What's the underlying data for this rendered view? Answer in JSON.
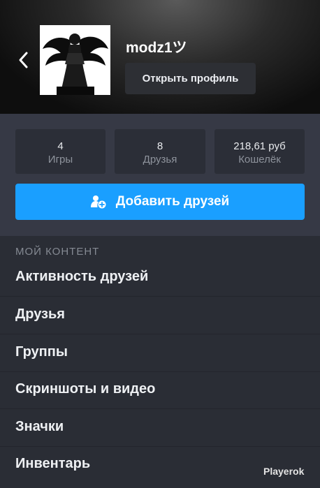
{
  "profile": {
    "username": "modz1ツ",
    "open_profile_label": "Открыть профиль"
  },
  "stats": [
    {
      "value": "4",
      "label": "Игры"
    },
    {
      "value": "8",
      "label": "Друзья"
    },
    {
      "value": "218,61 руб",
      "label": "Кошелёк"
    }
  ],
  "add_friends_label": "Добавить друзей",
  "content": {
    "section_title": "МОЙ КОНТЕНТ",
    "items": [
      {
        "label": "Активность друзей"
      },
      {
        "label": "Друзья"
      },
      {
        "label": "Группы"
      },
      {
        "label": "Скриншоты и видео"
      },
      {
        "label": "Значки"
      },
      {
        "label": "Инвентарь"
      }
    ]
  },
  "watermark": "Playerok",
  "colors": {
    "accent": "#1a9fff",
    "background": "#2a2d35",
    "stat_tile": "#2b2e37"
  }
}
